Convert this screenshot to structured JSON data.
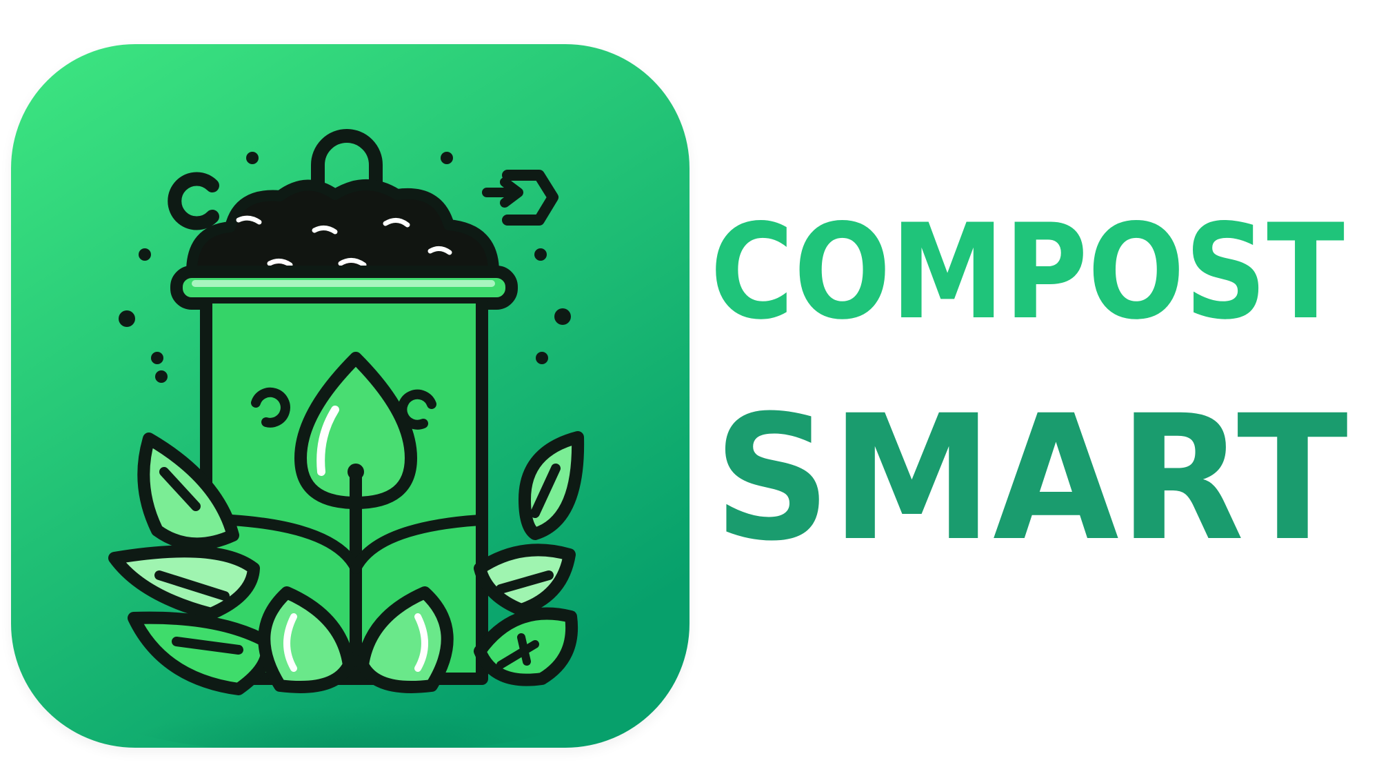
{
  "logo": {
    "line1": "COMPOST",
    "line2": "SMART"
  },
  "icon": {
    "name": "compost-bin-with-sprout-icon"
  },
  "colors": {
    "background": "#ffffff",
    "tile_light": "#3ee681",
    "tile_dark": "#0aa36c",
    "line1_color": "#1fc47a",
    "line2_color": "#1a9c6e",
    "outline": "#0e1a14",
    "leaf_light": "#5fe882",
    "leaf_mid": "#2fcf5f",
    "soil": "#111511"
  }
}
